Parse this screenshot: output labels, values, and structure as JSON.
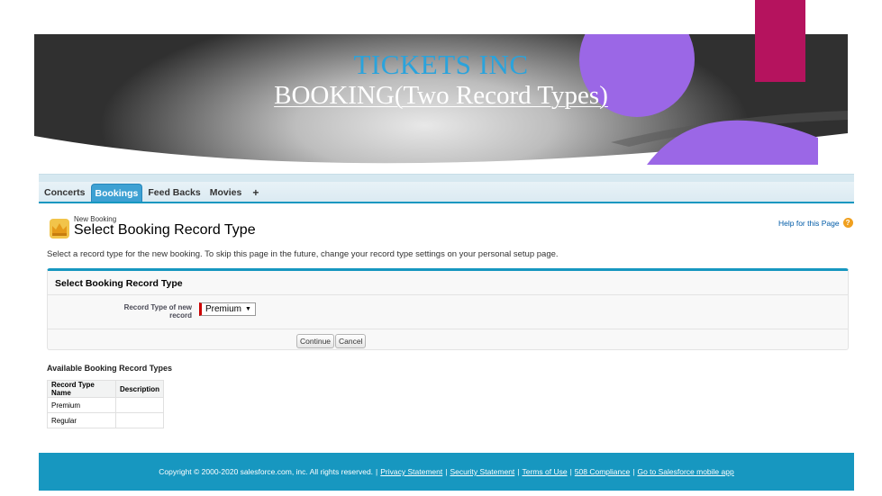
{
  "slide": {
    "title": "TICKETS INC",
    "subtitle": "BOOKING(Two Record Types)"
  },
  "tabs": [
    {
      "label": "Concerts",
      "active": false
    },
    {
      "label": "Bookings",
      "active": true
    },
    {
      "label": "Feed Backs",
      "active": false
    },
    {
      "label": "Movies",
      "active": false
    },
    {
      "label": "+",
      "active": false
    }
  ],
  "page": {
    "pre_title": "New Booking",
    "title": "Select Booking Record Type",
    "help_label": "Help for this Page",
    "help_icon": "?",
    "intro": "Select a record type for the new booking. To skip this page in the future, change your record type settings on your personal setup page."
  },
  "panel": {
    "header": "Select Booking Record Type",
    "field_label": "Record Type of new record",
    "field_value": "Premium",
    "caret": "▼",
    "continue_label": "Continue",
    "cancel_label": "Cancel"
  },
  "available": {
    "header": "Available Booking Record Types",
    "columns": [
      "Record Type Name",
      "Description"
    ],
    "rows": [
      {
        "name": "Premium",
        "description": ""
      },
      {
        "name": "Regular",
        "description": ""
      }
    ]
  },
  "footer": {
    "copyright": "Copyright © 2000-2020 salesforce.com, inc. All rights reserved.",
    "links": [
      "Privacy Statement",
      "Security Statement",
      "Terms of Use",
      "508 Compliance",
      "Go to Salesforce mobile app"
    ]
  },
  "colors": {
    "title": "#2aa3dc",
    "magenta": "#b5135e",
    "purple": "#9b67e6",
    "tab_active": "#3ea1d3",
    "footer": "#1797c0"
  }
}
